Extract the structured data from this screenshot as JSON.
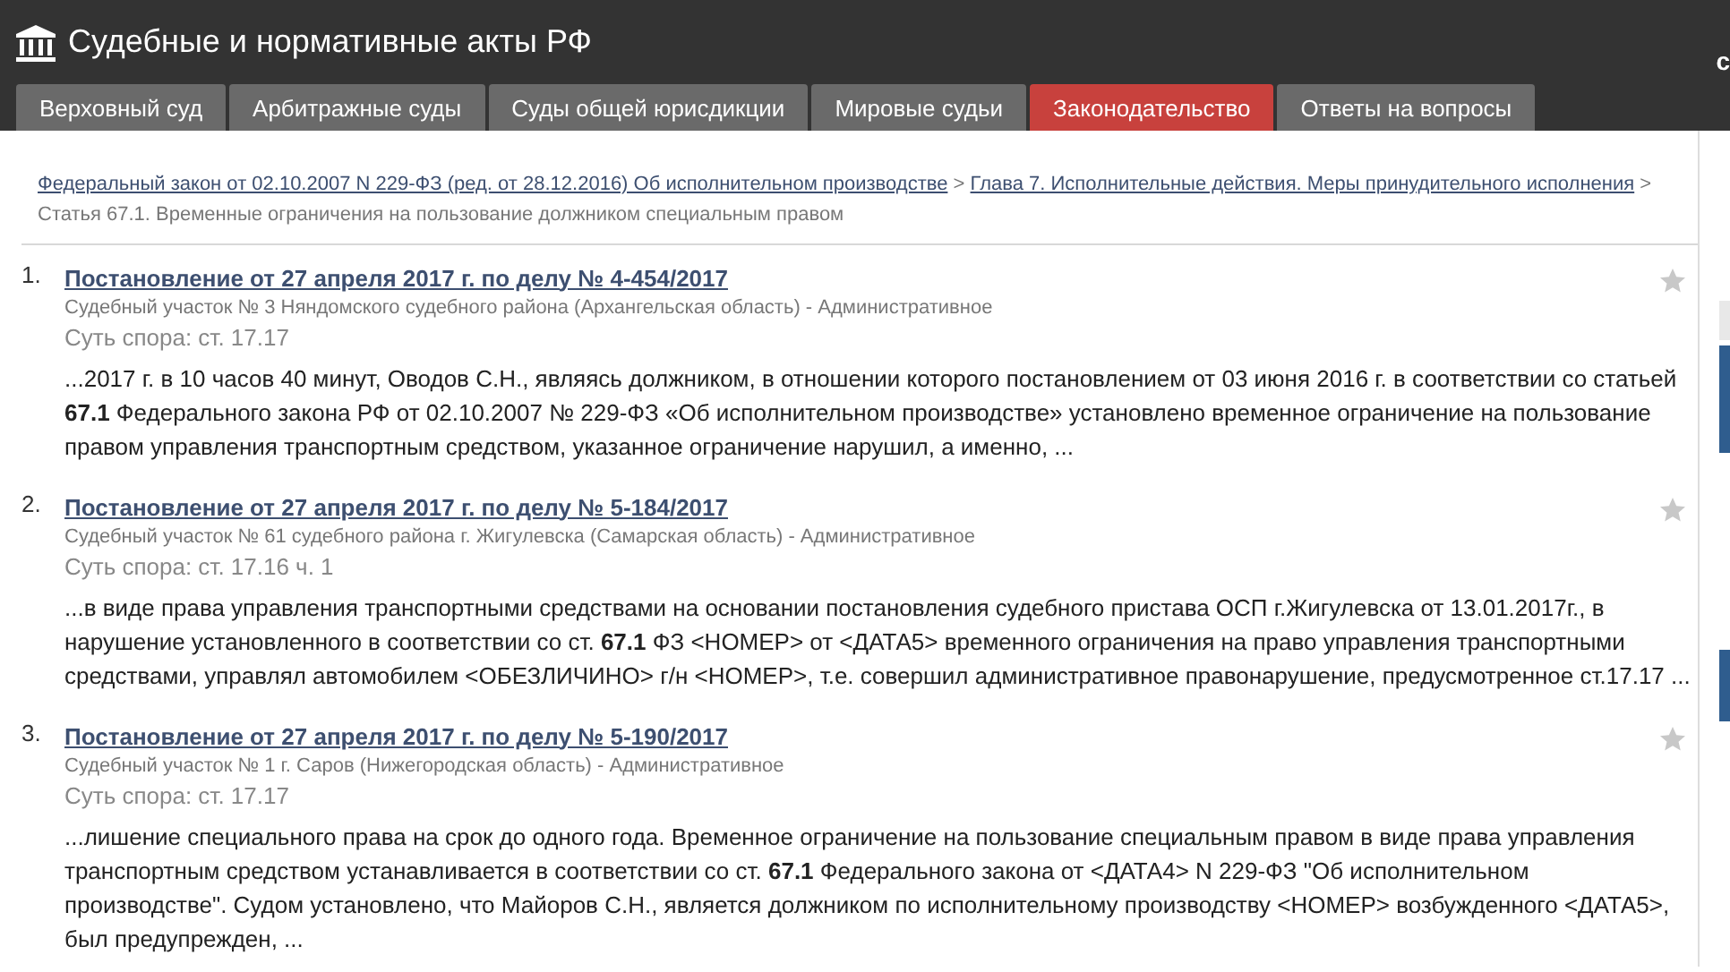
{
  "header": {
    "title": "Судебные и нормативные акты РФ",
    "right_text": "с"
  },
  "tabs": [
    {
      "label": "Верховный суд",
      "selected": false
    },
    {
      "label": "Арбитражные суды",
      "selected": false
    },
    {
      "label": "Суды общей юрисдикции",
      "selected": false
    },
    {
      "label": "Мировые судьи",
      "selected": false
    },
    {
      "label": "Законодательство",
      "selected": true
    },
    {
      "label": "Ответы на вопросы",
      "selected": false
    }
  ],
  "breadcrumb": [
    {
      "text": "Федеральный закон от 02.10.2007 N 229-ФЗ (ред. от 28.12.2016) Об исполнительном производстве",
      "kind": "link"
    },
    {
      "text": ">",
      "kind": "separator"
    },
    {
      "text": "Глава 7. Исполнительные действия. Меры принудительного исполнения",
      "kind": "link"
    },
    {
      "text": ">",
      "kind": "separator"
    },
    {
      "text": "Статья 67.1. Временные ограничения на пользование должником специальным правом",
      "kind": "current"
    }
  ],
  "results": [
    {
      "number": "1.",
      "title": "Постановление от 27 апреля 2017 г. по делу № 4-454/2017",
      "court": "Судебный участок № 3 Няндомского судебного района (Архангельская область) - Административное",
      "subject": "Суть спора: ст. 17.17",
      "snippet": "...2017 г. в 10 часов 40 минут, Оводов С.Н., являясь должником, в отношении которого постановлением от 03 июня 2016 г. в соответствии со статьей **67.1** Федерального закона РФ от 02.10.2007 № 229-ФЗ «Об исполнительном производстве» установлено временное ограничение на пользование правом управления транспортным средством, указанное ограничение нарушил, а именно, ..."
    },
    {
      "number": "2.",
      "title": "Постановление от 27 апреля 2017 г. по делу № 5-184/2017",
      "court": "Судебный участок № 61 судебного района г. Жигулевска (Самарская область) - Административное",
      "subject": "Суть спора: ст. 17.16 ч. 1",
      "snippet": "...в виде права управления транспортными средствами на основании постановления судебного пристава ОСП г.Жигулевска от 13.01.2017г., в нарушение установленного в соответствии со ст. **67.1** ФЗ <НОМЕР> от <ДАТА5> временного ограничения на право управления транспортными средствами, управлял автомобилем <ОБЕЗЛИЧИНО> г/н <НОМЕР>, т.е. совершил административное правонарушение, предусмотренное ст.17.17 ..."
    },
    {
      "number": "3.",
      "title": "Постановление от 27 апреля 2017 г. по делу № 5-190/2017",
      "court": "Судебный участок № 1 г. Саров (Нижегородская область) - Административное",
      "subject": "Суть спора: ст. 17.17",
      "snippet": "...лишение специального права на срок до одного года. Временное ограничение на пользование специальным правом в виде права управления транспортным средством устанавливается в соответствии со ст. **67.1** Федерального закона от <ДАТА4> N 229-ФЗ \"Об исполнительном производстве\". Судом установлено, что Майоров С.Н., является должником по исполнительному производству <НОМЕР> возбужденного <ДАТА5>, был предупрежден, ..."
    }
  ]
}
